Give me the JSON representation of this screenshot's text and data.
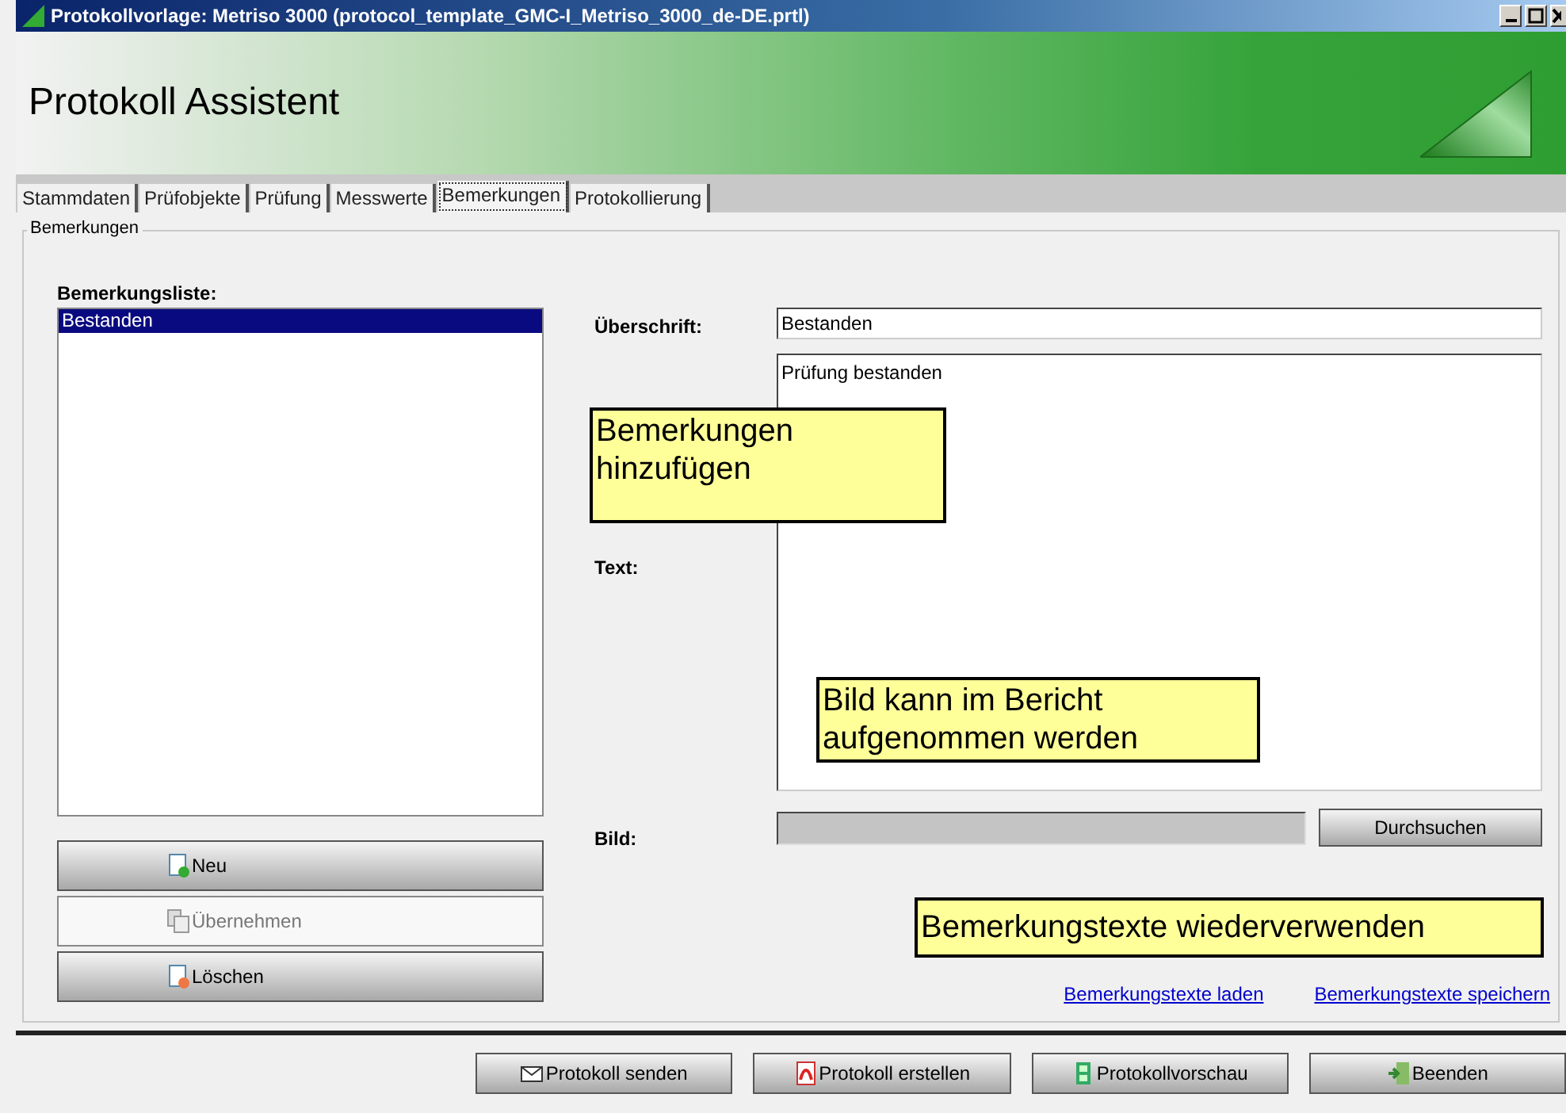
{
  "window": {
    "title": "Protokollvorlage: Metriso 3000 (protocol_template_GMC-I_Metriso_3000_de-DE.prtl)"
  },
  "header": {
    "title": "Protokoll Assistent"
  },
  "tabs": [
    {
      "label": "Stammdaten",
      "selected": false
    },
    {
      "label": "Prüfobjekte",
      "selected": false
    },
    {
      "label": "Prüfung",
      "selected": false
    },
    {
      "label": "Messwerte",
      "selected": false
    },
    {
      "label": "Bemerkungen",
      "selected": true
    },
    {
      "label": "Protokollierung",
      "selected": false
    }
  ],
  "group": {
    "title": "Bemerkungen"
  },
  "list": {
    "label": "Bemerkungsliste:",
    "items": [
      {
        "text": "Bestanden",
        "selected": true
      }
    ]
  },
  "list_buttons": [
    {
      "label": "Neu",
      "disabled": false
    },
    {
      "label": "Übernehmen",
      "disabled": true
    },
    {
      "label": "Löschen",
      "disabled": false
    }
  ],
  "form": {
    "heading_label": "Überschrift:",
    "heading_value": "Bestanden",
    "text_label": "Text:",
    "text_value": "Prüfung bestanden",
    "image_label": "Bild:",
    "browse_button": "Durchsuchen"
  },
  "links": [
    "Bemerkungstexte laden",
    "Bemerkungstexte speichern"
  ],
  "callouts": [
    "Bemerkungen hinzufügen",
    "Bild kann im Bericht aufgenommen werden",
    "Bemerkungstexte wiederverwenden"
  ],
  "footer_buttons": [
    "Protokoll senden",
    "Protokoll erstellen",
    "Protokollvorschau",
    "Beenden"
  ]
}
